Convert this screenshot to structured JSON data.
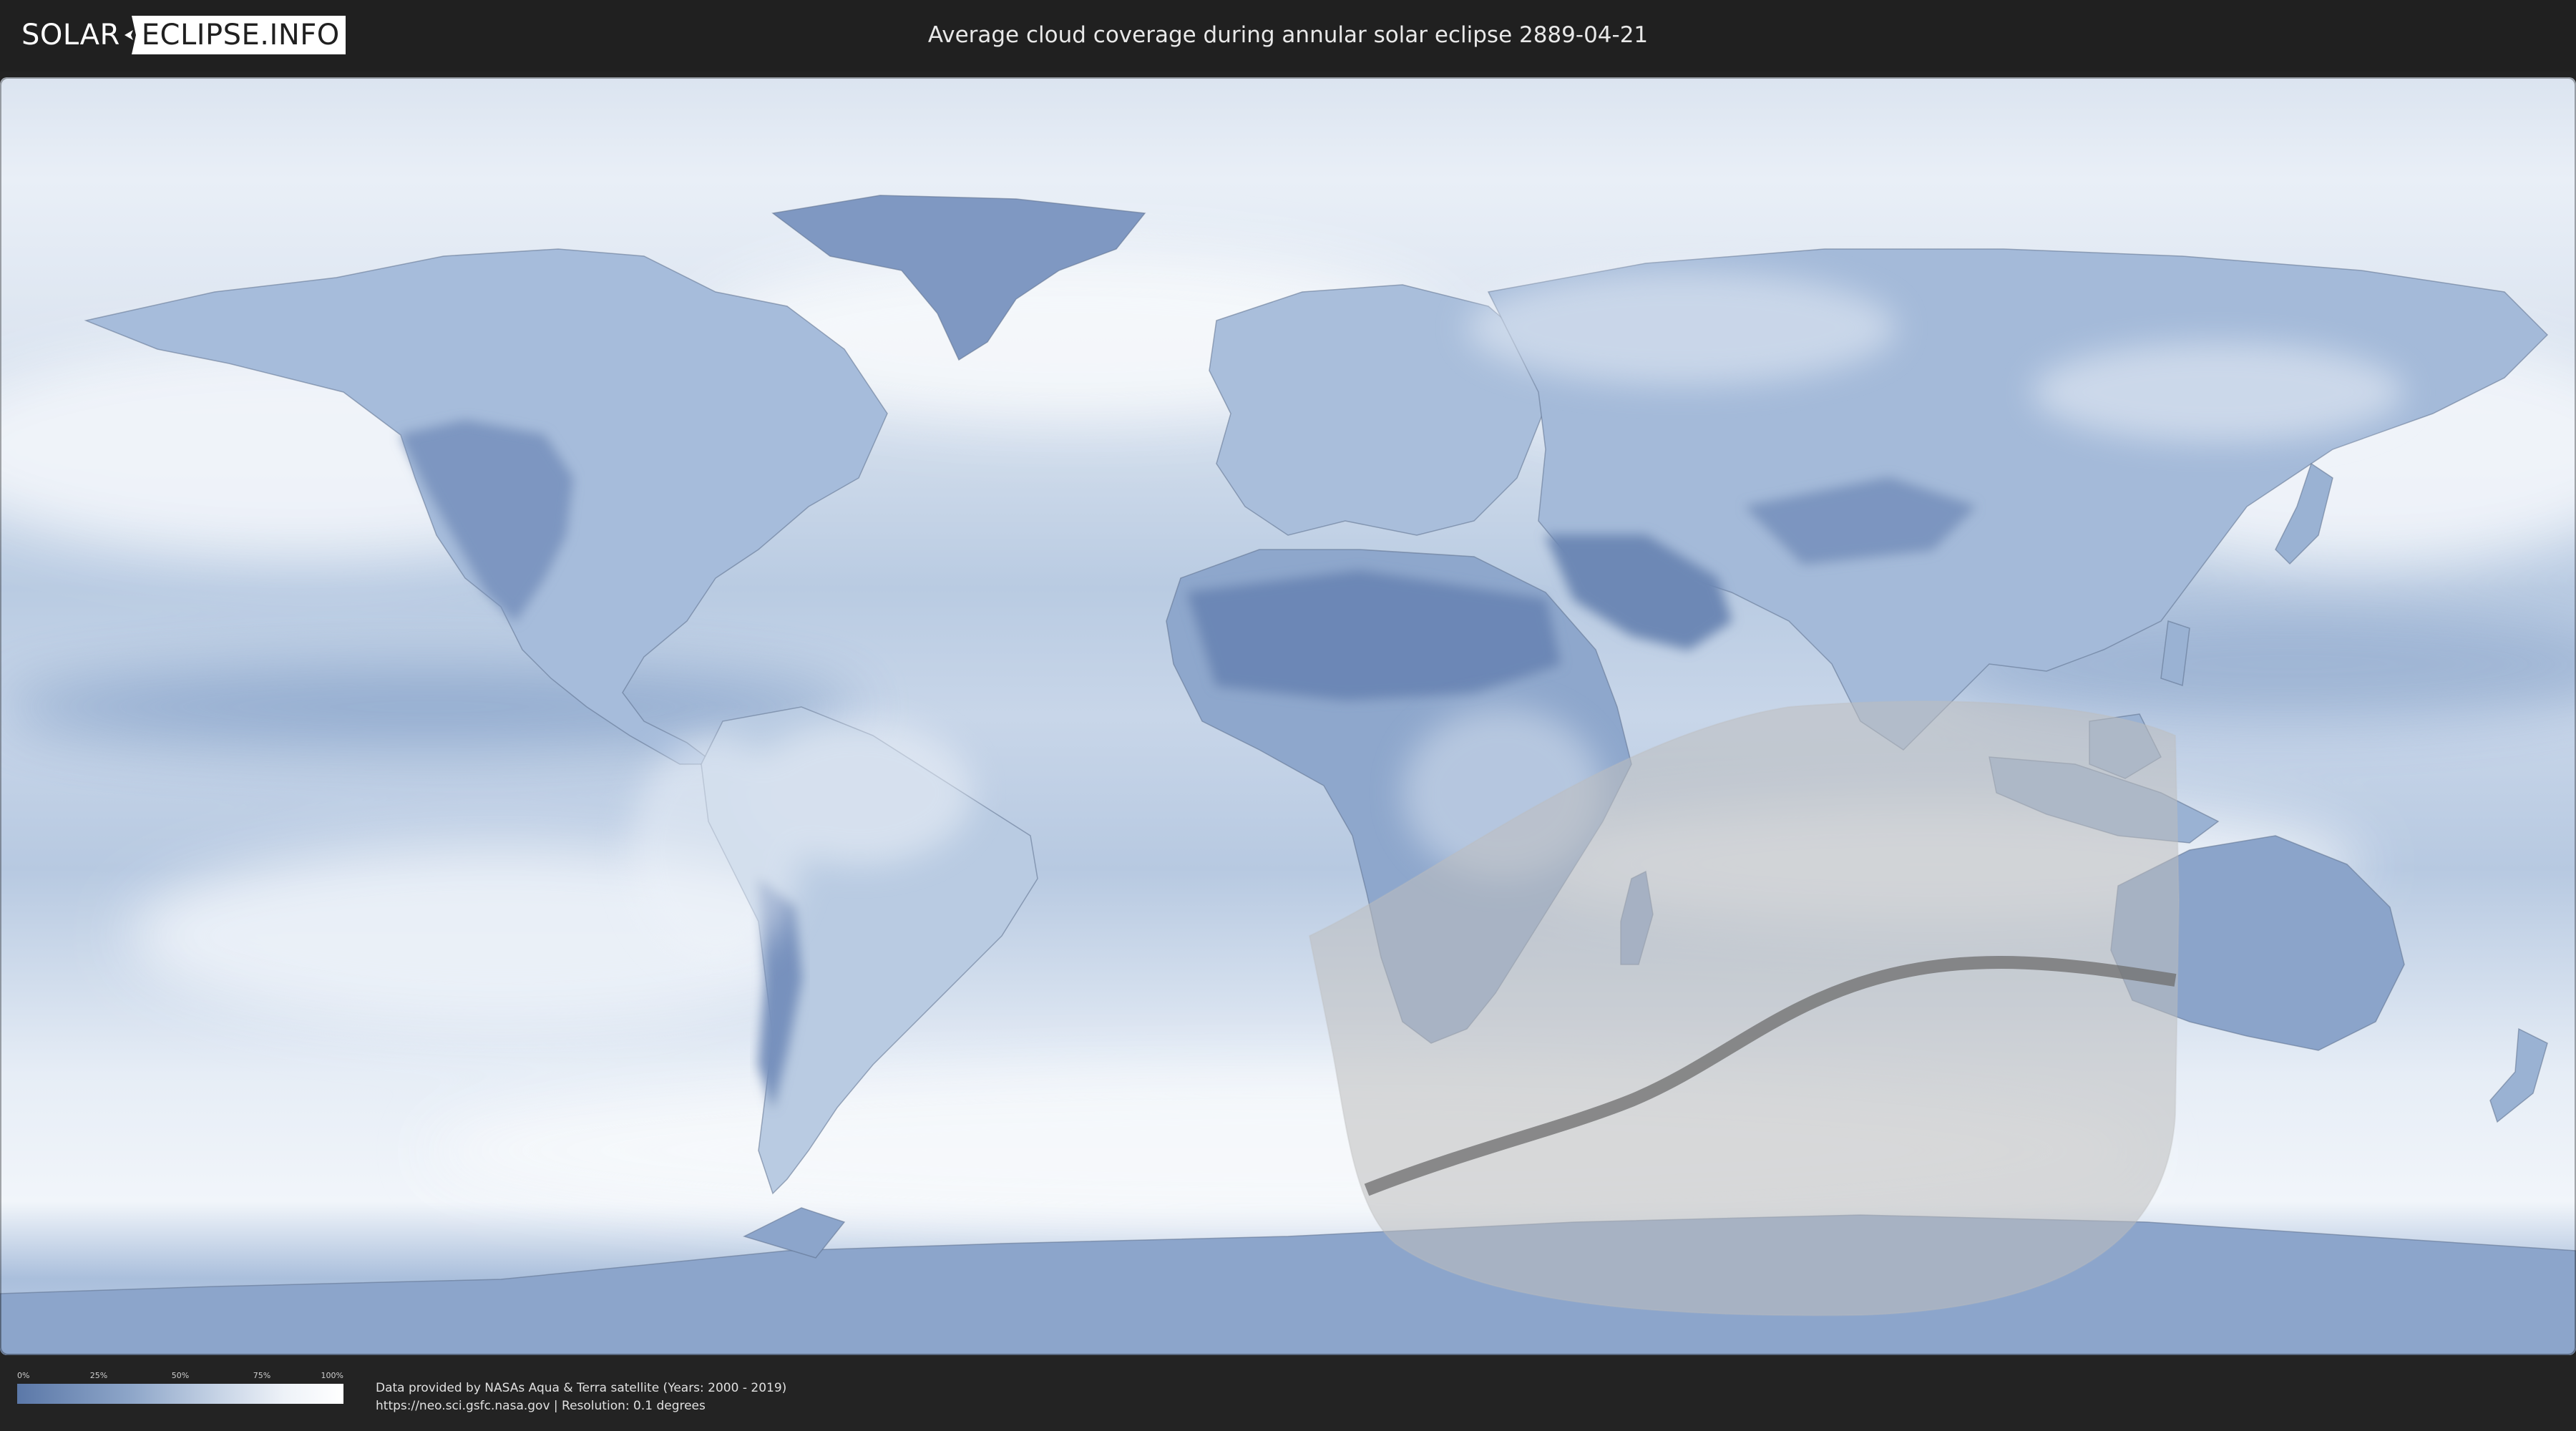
{
  "header": {
    "logo_left": "SOLAR",
    "logo_right": "ECLIPSE.INFO",
    "title": "Average cloud coverage during annular solar eclipse 2889-04-21"
  },
  "map": {
    "type": "equirectangular cloud coverage map",
    "eclipse_type": "annular",
    "date": "2889-04-21",
    "colors": {
      "ocean_base": "#a9bfdc",
      "cloud_high": "#f4f7fb",
      "cloud_low": "#6d88b5",
      "land_border": "#4f5f78",
      "visibility_zone": "#b9b9b9",
      "central_path": "#6e6e6e"
    }
  },
  "legend": {
    "ticks": [
      "0%",
      "25%",
      "50%",
      "75%",
      "100%"
    ],
    "color_low": "#5b78a8",
    "color_high": "#ffffff"
  },
  "footer": {
    "credit_line1": "Data provided by NASAs Aqua & Terra satellite (Years: 2000 - 2019)",
    "credit_line2": "https://neo.sci.gsfc.nasa.gov | Resolution: 0.1 degrees"
  }
}
